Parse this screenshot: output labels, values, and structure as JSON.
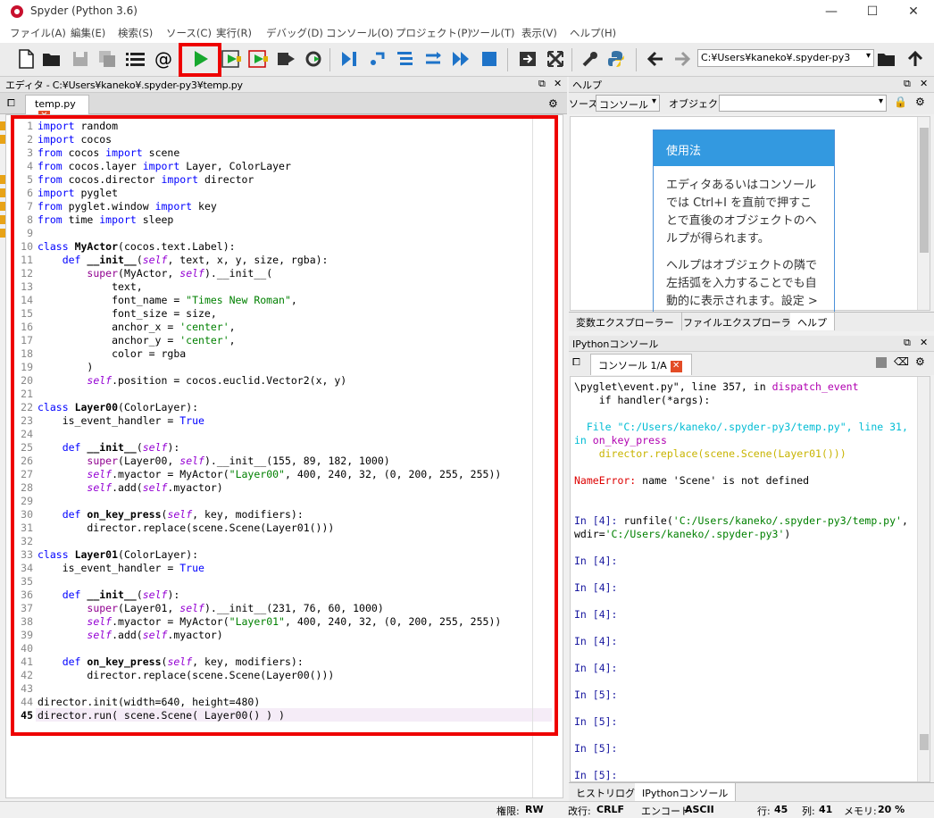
{
  "window": {
    "title": "Spyder (Python 3.6)",
    "minimize": "—",
    "maximize": "☐",
    "close": "✕"
  },
  "menu": [
    "ファイル(A)",
    "編集(E)",
    "検索(S)",
    "ソース(C)",
    "実行(R)",
    "デバッグ(D)",
    "コンソール(O)",
    "プロジェクト(P)",
    "ツール(T)",
    "表示(V)",
    "ヘルプ(H)"
  ],
  "toolbar": {
    "path": "C:¥Users¥kaneko¥.spyder-py3",
    "path_arrow": "▾"
  },
  "editor": {
    "header": "エディタ - C:¥Users¥kaneko¥.spyder-py3¥temp.py",
    "tab": "temp.py",
    "lines": [
      [
        [
          "import",
          "kw"
        ],
        [
          " random",
          ""
        ]
      ],
      [
        [
          "import",
          "kw"
        ],
        [
          " cocos",
          ""
        ]
      ],
      [
        [
          "from",
          "kw"
        ],
        [
          " cocos ",
          ""
        ],
        [
          "import",
          "kw"
        ],
        [
          " scene",
          ""
        ]
      ],
      [
        [
          "from",
          "kw"
        ],
        [
          " cocos.layer ",
          ""
        ],
        [
          "import",
          "kw"
        ],
        [
          " Layer, ColorLayer",
          ""
        ]
      ],
      [
        [
          "from",
          "kw"
        ],
        [
          " cocos.director ",
          ""
        ],
        [
          "import",
          "kw"
        ],
        [
          " director",
          ""
        ]
      ],
      [
        [
          "import",
          "kw"
        ],
        [
          " pyglet",
          ""
        ]
      ],
      [
        [
          "from",
          "kw"
        ],
        [
          " pyglet.window ",
          ""
        ],
        [
          "import",
          "kw"
        ],
        [
          " key",
          ""
        ]
      ],
      [
        [
          "from",
          "kw"
        ],
        [
          " time ",
          ""
        ],
        [
          "import",
          "kw"
        ],
        [
          " sleep",
          ""
        ]
      ],
      [],
      [
        [
          "class",
          "kw"
        ],
        [
          " ",
          ""
        ],
        [
          "MyActor",
          "fn"
        ],
        [
          "(cocos.text.Label):",
          ""
        ]
      ],
      [
        [
          "    ",
          ""
        ],
        [
          "def",
          "kw"
        ],
        [
          " ",
          ""
        ],
        [
          "__init__",
          "fn"
        ],
        [
          "(",
          ""
        ],
        [
          "self",
          "sf"
        ],
        [
          ", text, x, y, size, rgba):",
          ""
        ]
      ],
      [
        [
          "        ",
          ""
        ],
        [
          "super",
          "bi"
        ],
        [
          "(MyActor, ",
          ""
        ],
        [
          "self",
          "sf"
        ],
        [
          ").__init__(",
          ""
        ]
      ],
      [
        [
          "            text,",
          ""
        ]
      ],
      [
        [
          "            font_name = ",
          ""
        ],
        [
          "\"Times New Roman\"",
          "st"
        ],
        [
          ",",
          ""
        ]
      ],
      [
        [
          "            font_size = size,",
          ""
        ]
      ],
      [
        [
          "            anchor_x = ",
          ""
        ],
        [
          "'center'",
          "st"
        ],
        [
          ",",
          ""
        ]
      ],
      [
        [
          "            anchor_y = ",
          ""
        ],
        [
          "'center'",
          "st"
        ],
        [
          ",",
          ""
        ]
      ],
      [
        [
          "            color = rgba",
          ""
        ]
      ],
      [
        [
          "        )",
          ""
        ]
      ],
      [
        [
          "        ",
          ""
        ],
        [
          "self",
          "sf"
        ],
        [
          ".position = cocos.euclid.Vector2(x, y)",
          ""
        ]
      ],
      [],
      [
        [
          "class",
          "kw"
        ],
        [
          " ",
          ""
        ],
        [
          "Layer00",
          "fn"
        ],
        [
          "(ColorLayer):",
          ""
        ]
      ],
      [
        [
          "    is_event_handler = ",
          ""
        ],
        [
          "True",
          "kw"
        ]
      ],
      [],
      [
        [
          "    ",
          ""
        ],
        [
          "def",
          "kw"
        ],
        [
          " ",
          ""
        ],
        [
          "__init__",
          "fn"
        ],
        [
          "(",
          ""
        ],
        [
          "self",
          "sf"
        ],
        [
          "):",
          ""
        ]
      ],
      [
        [
          "        ",
          ""
        ],
        [
          "super",
          "bi"
        ],
        [
          "(Layer00, ",
          ""
        ],
        [
          "self",
          "sf"
        ],
        [
          ").__init__(155, 89, 182, 1000)",
          ""
        ]
      ],
      [
        [
          "        ",
          ""
        ],
        [
          "self",
          "sf"
        ],
        [
          ".myactor = MyActor(",
          ""
        ],
        [
          "\"Layer00\"",
          "st"
        ],
        [
          ", 400, 240, 32, (0, 200, 255, 255))",
          ""
        ]
      ],
      [
        [
          "        ",
          ""
        ],
        [
          "self",
          "sf"
        ],
        [
          ".add(",
          ""
        ],
        [
          "self",
          "sf"
        ],
        [
          ".myactor)",
          ""
        ]
      ],
      [],
      [
        [
          "    ",
          ""
        ],
        [
          "def",
          "kw"
        ],
        [
          " ",
          ""
        ],
        [
          "on_key_press",
          "fn"
        ],
        [
          "(",
          ""
        ],
        [
          "self",
          "sf"
        ],
        [
          ", key, modifiers):",
          ""
        ]
      ],
      [
        [
          "        director.replace(scene.Scene(Layer01()))",
          ""
        ]
      ],
      [],
      [
        [
          "class",
          "kw"
        ],
        [
          " ",
          ""
        ],
        [
          "Layer01",
          "fn"
        ],
        [
          "(ColorLayer):",
          ""
        ]
      ],
      [
        [
          "    is_event_handler = ",
          ""
        ],
        [
          "True",
          "kw"
        ]
      ],
      [],
      [
        [
          "    ",
          ""
        ],
        [
          "def",
          "kw"
        ],
        [
          " ",
          ""
        ],
        [
          "__init__",
          "fn"
        ],
        [
          "(",
          ""
        ],
        [
          "self",
          "sf"
        ],
        [
          "):",
          ""
        ]
      ],
      [
        [
          "        ",
          ""
        ],
        [
          "super",
          "bi"
        ],
        [
          "(Layer01, ",
          ""
        ],
        [
          "self",
          "sf"
        ],
        [
          ").__init__(231, 76, 60, 1000)",
          ""
        ]
      ],
      [
        [
          "        ",
          ""
        ],
        [
          "self",
          "sf"
        ],
        [
          ".myactor = MyActor(",
          ""
        ],
        [
          "\"Layer01\"",
          "st"
        ],
        [
          ", 400, 240, 32, (0, 200, 255, 255))",
          ""
        ]
      ],
      [
        [
          "        ",
          ""
        ],
        [
          "self",
          "sf"
        ],
        [
          ".add(",
          ""
        ],
        [
          "self",
          "sf"
        ],
        [
          ".myactor)",
          ""
        ]
      ],
      [],
      [
        [
          "    ",
          ""
        ],
        [
          "def",
          "kw"
        ],
        [
          " ",
          ""
        ],
        [
          "on_key_press",
          "fn"
        ],
        [
          "(",
          ""
        ],
        [
          "self",
          "sf"
        ],
        [
          ", key, modifiers):",
          ""
        ]
      ],
      [
        [
          "        director.replace(scene.Scene(Layer00()))",
          ""
        ]
      ],
      [],
      [
        [
          "director.init(width=640, height=480)",
          ""
        ]
      ],
      [
        [
          "director.run( scene.Scene( Layer00() ) )",
          ""
        ]
      ]
    ]
  },
  "help": {
    "header": "ヘルプ",
    "source_label": "ソース",
    "source_value": "コンソール",
    "object_label": "オブジェクト",
    "usage_title": "使用法",
    "usage_p1": "エディタあるいはコンソールでは Ctrl+I を直前で押すことで直後のオブジェクトのヘルプが得られます。",
    "usage_p2": "ヘルプはオブジェクトの隣で左括弧を入力することでも自動的に表示されます。設定 >",
    "tabs": [
      "変数エクスプローラー",
      "ファイルエクスプローラー",
      "ヘルプ"
    ]
  },
  "console": {
    "header": "IPythonコンソール",
    "tab": "コンソール 1/A",
    "lines": [
      [
        "\\pyglet\\event.py\", line 357, in dispatch_event",
        "tb"
      ],
      [
        "    if handler(*args):",
        "plain"
      ],
      [
        "",
        ""
      ],
      [
        "  File \"C:/Users/kaneko/.spyder-py3/temp.py\", line 31,",
        "file"
      ],
      [
        "in on_key_press",
        "mag"
      ],
      [
        "    director.replace(scene.Scene(Layer01()))",
        "yel"
      ],
      [
        "",
        ""
      ],
      [
        "NameError: name 'Scene' is not defined",
        "err"
      ],
      [
        "",
        ""
      ],
      [
        "",
        ""
      ],
      [
        "In [4]: runfile('C:/Users/kaneko/.spyder-py3/temp.py',",
        "run"
      ],
      [
        "wdir='C:/Users/kaneko/.spyder-py3')",
        "run2"
      ],
      [
        "",
        ""
      ],
      [
        "In [4]:",
        "in"
      ],
      [
        "",
        ""
      ],
      [
        "In [4]:",
        "in"
      ],
      [
        "",
        ""
      ],
      [
        "In [4]:",
        "in"
      ],
      [
        "",
        ""
      ],
      [
        "In [4]:",
        "in"
      ],
      [
        "",
        ""
      ],
      [
        "In [4]:",
        "in"
      ],
      [
        "",
        ""
      ],
      [
        "In [5]:",
        "in"
      ],
      [
        "",
        ""
      ],
      [
        "In [5]:",
        "in"
      ],
      [
        "",
        ""
      ],
      [
        "In [5]:",
        "in"
      ],
      [
        "",
        ""
      ],
      [
        "In [5]:",
        "in"
      ]
    ],
    "tabs": [
      "ヒストリログ",
      "IPythonコンソール"
    ]
  },
  "status": {
    "perm_label": "権限:",
    "perm": "RW",
    "eol_label": "改行:",
    "eol": "CRLF",
    "enc_label": "エンコード",
    "enc": "ASCII",
    "line_label": "行:",
    "line": "45",
    "col_label": "列:",
    "col": "41",
    "mem_label": "メモリ:",
    "mem": "20 %"
  }
}
